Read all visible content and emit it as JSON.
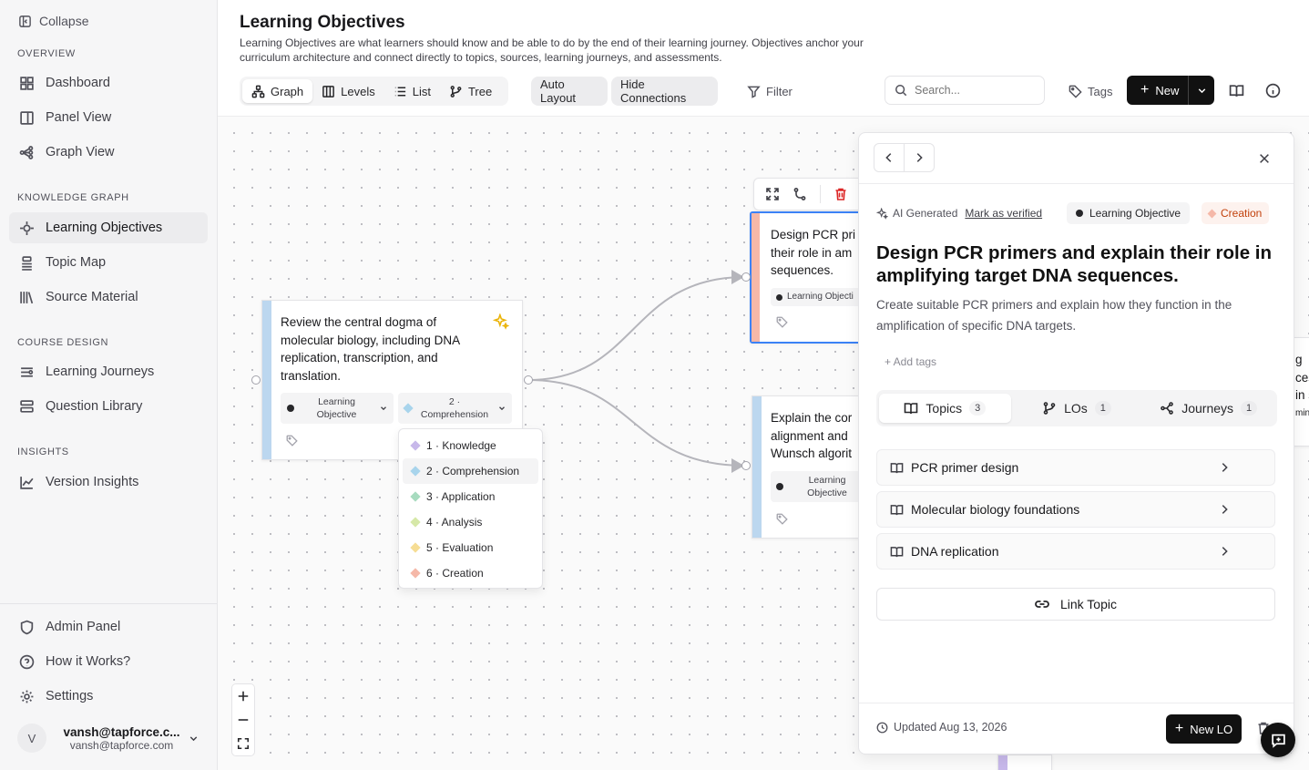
{
  "sidebar": {
    "collapse_label": "Collapse",
    "sections": {
      "overview": "OVERVIEW",
      "knowledge_graph": "KNOWLEDGE GRAPH",
      "course_design": "COURSE DESIGN",
      "insights": "INSIGHTS"
    },
    "items": {
      "dashboard": "Dashboard",
      "panel_view": "Panel View",
      "graph_view": "Graph View",
      "learning_objectives": "Learning Objectives",
      "topic_map": "Topic Map",
      "source_material": "Source Material",
      "learning_journeys": "Learning Journeys",
      "question_library": "Question Library",
      "version_insights": "Version Insights",
      "admin_panel": "Admin Panel",
      "how_it_works": "How it Works?",
      "settings": "Settings"
    },
    "user": {
      "initial": "V",
      "name": "vansh@tapforce.c...",
      "email": "vansh@tapforce.com"
    }
  },
  "header": {
    "title": "Learning Objectives",
    "description": "Learning Objectives are what learners should know and be able to do by the end of their learning journey. Objectives anchor your curriculum architecture and connect directly to topics, sources, learning journeys, and assessments."
  },
  "toolbar": {
    "views": {
      "graph": "Graph",
      "levels": "Levels",
      "list": "List",
      "tree": "Tree"
    },
    "auto_layout": "Auto Layout",
    "hide_connections": "Hide Connections",
    "filter": "Filter",
    "search_placeholder": "Search...",
    "tags": "Tags",
    "new": "New"
  },
  "canvas": {
    "node_main": {
      "title": "Review the central dogma of molecular biology, including DNA replication, transcription, and translation.",
      "type_chip": "Learning Objective",
      "level_chip": "2 · Comprehension"
    },
    "node_design": {
      "title": "Design PCR pri their role in am sequences.",
      "type_chip": "Learning Objecti"
    },
    "node_explain": {
      "title": "Explain the cor alignment and Wunsch algorit",
      "type_chip": "Learning Objective"
    },
    "level_dropdown": [
      {
        "label": "1 · Knowledge",
        "color": "#c7b8ea"
      },
      {
        "label": "2 · Comprehension",
        "color": "#a8d4ec"
      },
      {
        "label": "3 · Application",
        "color": "#a7dbbf"
      },
      {
        "label": "4 · Analysis",
        "color": "#d6e8a8"
      },
      {
        "label": "5 · Evaluation",
        "color": "#f6dd94"
      },
      {
        "label": "6 · Creation",
        "color": "#f5b8a8"
      }
    ],
    "right_fragments": {
      "a": "g",
      "b": "ces",
      "c": "in s",
      "d": "min"
    }
  },
  "panel": {
    "ai_generated": "AI Generated",
    "mark_verified": "Mark as verified",
    "type_pill": "Learning Objective",
    "level_pill": "Creation",
    "title": "Design PCR primers and explain their role in amplifying target DNA sequences.",
    "description": "Create suitable PCR primers and explain how they function in the amplification of specific DNA targets.",
    "add_tags": "+ Add tags",
    "tabs": [
      {
        "label": "Topics",
        "count": "3"
      },
      {
        "label": "LOs",
        "count": "1"
      },
      {
        "label": "Journeys",
        "count": "1"
      }
    ],
    "topics": [
      "PCR primer design",
      "Molecular biology foundations",
      "DNA replication"
    ],
    "link_topic": "Link Topic",
    "updated": "Updated Aug 13, 2026",
    "new_lo": "New LO"
  },
  "colors": {
    "accent_blue": "#3b82f6",
    "node_bar_blue": "#bcd7ef",
    "node_bar_creation": "#f5b8a8",
    "delete_red": "#dc2626"
  }
}
